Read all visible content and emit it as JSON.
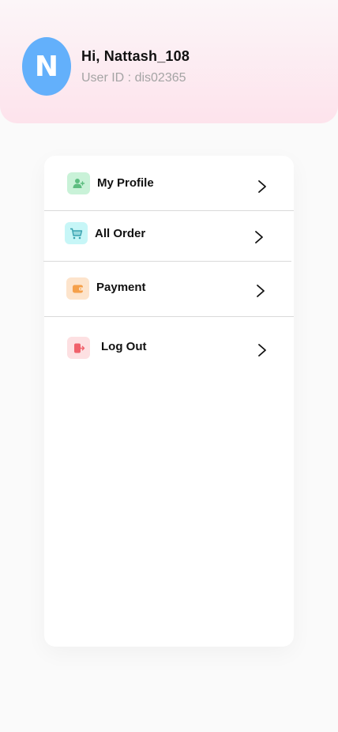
{
  "user": {
    "avatar_letter": "N",
    "greeting": "Hi, Nattash_108",
    "user_id": "User ID : dis02365"
  },
  "colors": {
    "avatar": "#63b0fb",
    "header_gradient_bottom": "#fde3ec",
    "profile_icon_bg": "#c9f2d8",
    "order_icon_bg": "#c7f6f7",
    "payment_icon_bg": "#fde4cc",
    "logout_icon_bg": "#fde0e2"
  },
  "menu": {
    "items": [
      {
        "label": "My Profile",
        "icon": "add-user-icon"
      },
      {
        "label": "All Order",
        "icon": "cart-icon"
      },
      {
        "label": "Payment",
        "icon": "wallet-icon"
      },
      {
        "label": "Log Out",
        "icon": "logout-icon"
      }
    ]
  }
}
